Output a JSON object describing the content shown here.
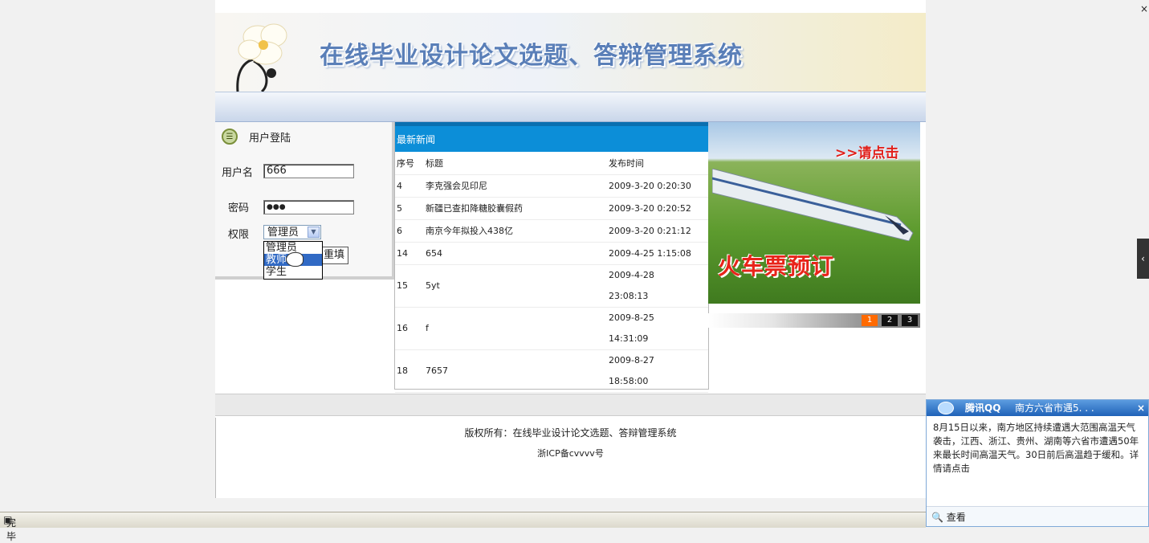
{
  "site": {
    "title": "在线毕业设计论文选题、答辩管理系统"
  },
  "login": {
    "header": "用户登陆",
    "username_label": "用户名",
    "username_value": "666",
    "password_label": "密码",
    "password_value": "●●●",
    "role_label": "权限",
    "role_selected": "管理员",
    "role_options": [
      "管理员",
      "教师",
      "学生"
    ],
    "reset_label": "重填"
  },
  "news": {
    "header": "最新新闻",
    "columns": [
      "序号",
      "标题",
      "发布时间"
    ],
    "rows": [
      {
        "id": "4",
        "title": "李克强会见印尼",
        "date": "2009-3-20 0:20:30"
      },
      {
        "id": "5",
        "title": "新疆已查扣降糖胶囊假药",
        "date": "2009-3-20 0:20:52"
      },
      {
        "id": "6",
        "title": "南京今年拟投入438亿",
        "date": "2009-3-20 0:21:12"
      },
      {
        "id": "14",
        "title": "654",
        "date": "2009-4-25 1:15:08"
      },
      {
        "id": "15",
        "title": "5yt",
        "date1": "2009-4-28",
        "date2": "23:08:13"
      },
      {
        "id": "16",
        "title": "f",
        "date1": "2009-8-25",
        "date2": "14:31:09"
      },
      {
        "id": "18",
        "title": "7657",
        "date1": "2009-8-27",
        "date2": "18:58:00"
      }
    ]
  },
  "promo": {
    "cta": ">>请点击",
    "caption": "火车票预订",
    "pages": [
      "1",
      "2",
      "3"
    ],
    "active_page_color": "#ff6a00"
  },
  "footer": {
    "copyright": "版权所有：在线毕业设计论文选题、答辩管理系统",
    "icp": "浙ICP备cvvvv号"
  },
  "qq_popup": {
    "brand": "腾讯QQ",
    "title": "南方六省市遇5. . .",
    "close": "×",
    "body": "8月15日以来，南方地区持续遭遇大范围高温天气袭击，江西、浙江、贵州、湖南等六省市遭遇50年来最长时间高温天气。30日前后高温趋于缓和。详情请点击",
    "view_label": "查看"
  },
  "status": {
    "text": "完毕"
  }
}
